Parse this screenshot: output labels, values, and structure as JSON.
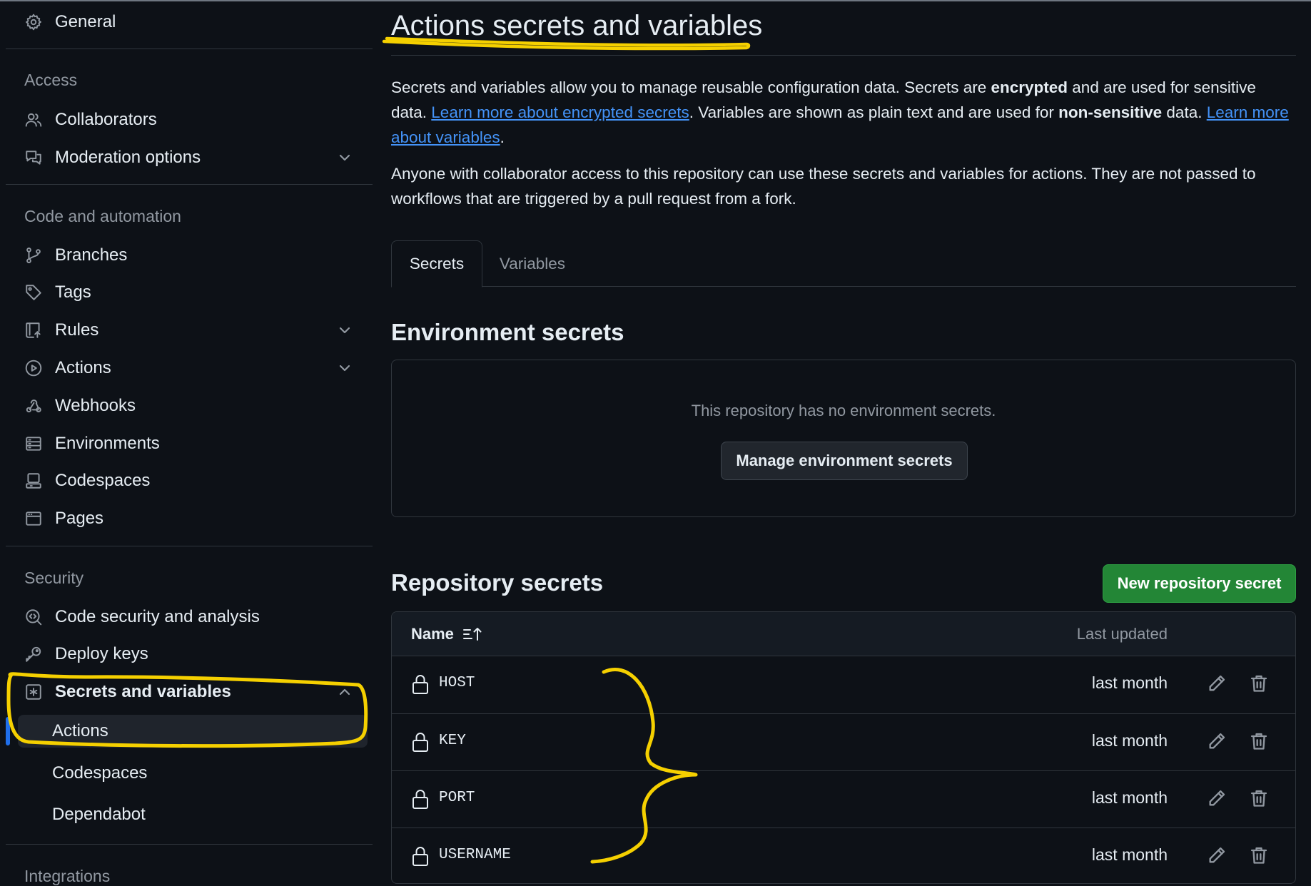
{
  "sidebar": {
    "general": "General",
    "sections": {
      "access": "Access",
      "code_automation": "Code and automation",
      "security": "Security",
      "integrations": "Integrations"
    },
    "items": {
      "collaborators": "Collaborators",
      "moderation": "Moderation options",
      "branches": "Branches",
      "tags": "Tags",
      "rules": "Rules",
      "actions": "Actions",
      "webhooks": "Webhooks",
      "environments": "Environments",
      "codespaces": "Codespaces",
      "pages": "Pages",
      "code_security": "Code security and analysis",
      "deploy_keys": "Deploy keys",
      "secrets_vars": "Secrets and variables",
      "sub_actions": "Actions",
      "sub_codespaces": "Codespaces",
      "sub_dependabot": "Dependabot"
    }
  },
  "main": {
    "title": "Actions secrets and variables",
    "intro": {
      "p1_a": "Secrets and variables allow you to manage reusable configuration data. Secrets are ",
      "p1_b": "encrypted",
      "p1_c": " and are used for sensitive data. ",
      "p1_link1": "Learn more about encrypted secrets",
      "p1_d": ". Variables are shown as plain text and are used for ",
      "p1_e": "non-sensitive",
      "p1_f": " data. ",
      "p1_link2": "Learn more about variables",
      "p1_g": ".",
      "p2": "Anyone with collaborator access to this repository can use these secrets and variables for actions. They are not passed to workflows that are triggered by a pull request from a fork."
    },
    "tabs": [
      "Secrets",
      "Variables"
    ],
    "env_secrets": {
      "heading": "Environment secrets",
      "empty": "This repository has no environment secrets.",
      "button": "Manage environment secrets"
    },
    "repo_secrets": {
      "heading": "Repository secrets",
      "new_button": "New repository secret",
      "col_name": "Name",
      "col_updated": "Last updated",
      "rows": [
        {
          "name": "HOST",
          "updated": "last month"
        },
        {
          "name": "KEY",
          "updated": "last month"
        },
        {
          "name": "PORT",
          "updated": "last month"
        },
        {
          "name": "USERNAME",
          "updated": "last month"
        }
      ]
    }
  },
  "colors": {
    "background": "#0d1117",
    "accent_link": "#4493f8",
    "primary_button": "#238636",
    "annotation": "#f5d000"
  }
}
